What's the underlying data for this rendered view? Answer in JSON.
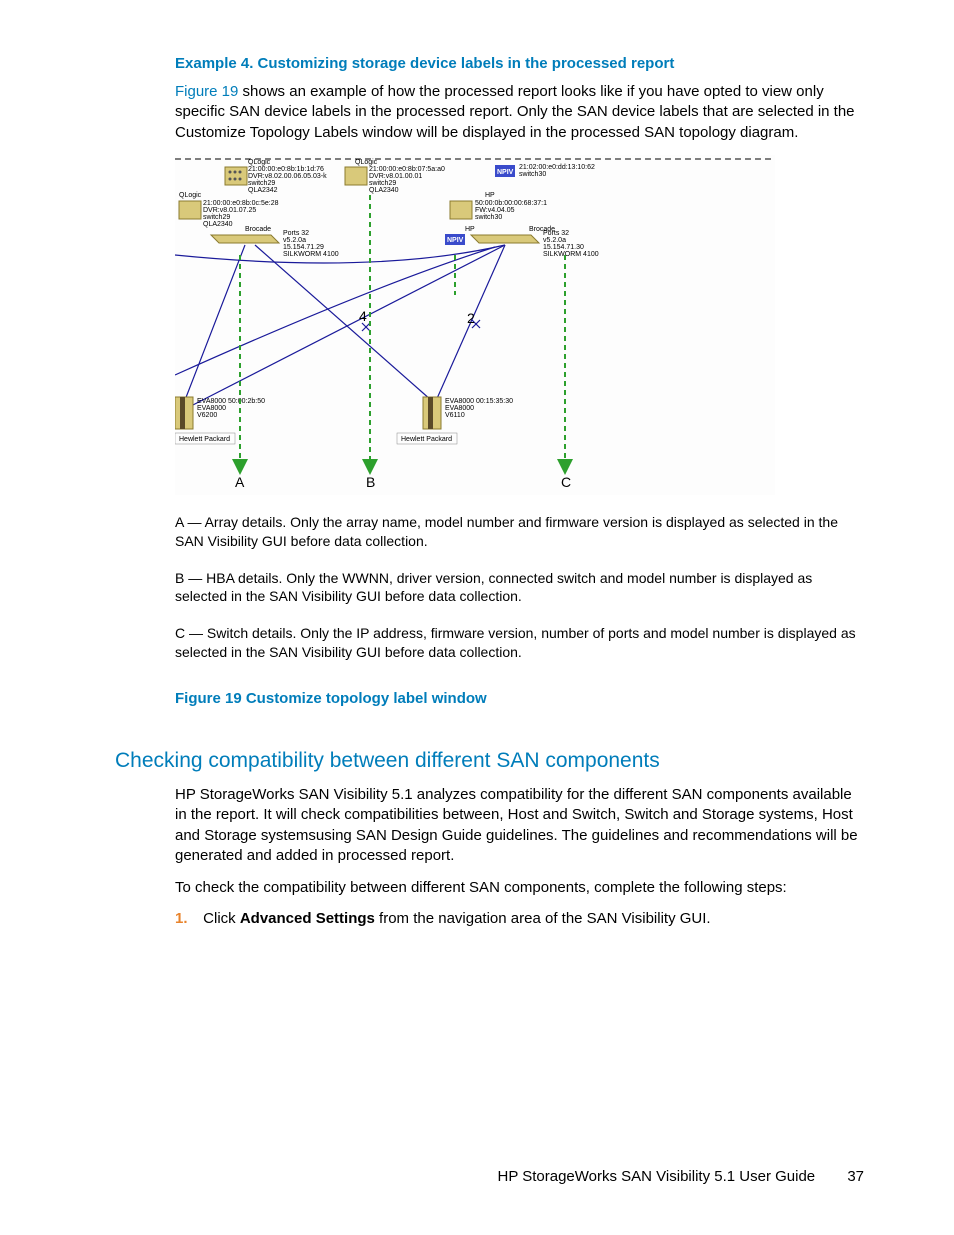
{
  "example_heading": "Example 4. Customizing storage device labels in the processed report",
  "intro_link": "Figure 19",
  "intro_rest": " shows an example of how the processed report looks like if you have opted to view only specific SAN device labels in the processed report. Only the SAN device labels that are selected in the Customize Topology Labels window will be displayed in the processed SAN topology diagram.",
  "diagram": {
    "hba1_vendor": "QLogic",
    "hba1_lines": [
      "21:00:00:e0:8b:1b:1d:76",
      "DVR:v8.02.00.06.05.03-k",
      "switch29",
      "QLA2342"
    ],
    "hba2_vendor": "QLogic",
    "hba2_lines": [
      "21:00:00:e0:8b:07:5a:a0",
      "DVR:v8.01.00.01",
      "switch29",
      "QLA2340"
    ],
    "hba3_lines": [
      "21:02:00:e0:dd:13:10:62",
      "switch30"
    ],
    "hba4_vendor": "QLogic",
    "hba4_lines": [
      "21:00:00:e0:8b:0c:5e:28",
      "DVR:v8.01.07.25",
      "switch29",
      "QLA2340"
    ],
    "hp_label": "HP",
    "hp_lines": [
      "50:00:0b:00:00:68:37:1",
      "FW:v4.04.05",
      "switch30"
    ],
    "switch1_vendor": "Brocade",
    "switch1_lines": [
      "Ports 32",
      "v5.2.0a",
      "15.154.71.29",
      "SILKWORM 4100"
    ],
    "switch2_vendor": "Brocade",
    "switch2_lines": [
      "Ports 32",
      "v5.2.0a",
      "15.154.71.30",
      "SILKWORM 4100"
    ],
    "npiv": "NPIV",
    "array1_lines": [
      "EVA8000  50:00:2b:50",
      "EVA8000",
      "V6200"
    ],
    "array1_footer": "Hewlett Packard",
    "array2_lines": [
      "EVA8000  00:15:35:30",
      "EVA8000",
      "V6110"
    ],
    "array2_footer": "Hewlett Packard",
    "num4": "4",
    "num2": "2",
    "labelA": "A",
    "labelB": "B",
    "labelC": "C"
  },
  "legendA": "A — Array details. Only the array name, model number and firmware version is displayed as selected in the SAN Visibility GUI before data collection.",
  "legendB": "B — HBA details. Only the WWNN, driver version, connected switch and model number is displayed as selected in the SAN Visibility GUI before data collection.",
  "legendC": "C — Switch details. Only the IP address, firmware version, number of ports and model number is displayed as selected in the SAN Visibility GUI before data collection.",
  "figure_caption": "Figure 19 Customize topology label window",
  "section_heading": "Checking compatibility between different SAN components",
  "section_p1": "HP StorageWorks SAN Visibility 5.1 analyzes compatibility for the different SAN components available in the report. It will check compatibilities between, Host and Switch, Switch and Storage systems, Host and Storage systemsusing SAN Design Guide guidelines. The guidelines and recommendations will be generated and added in processed report.",
  "section_p2": "To check the compatibility between different SAN components, complete the following steps:",
  "step1_num": "1.",
  "step1_a": "Click ",
  "step1_bold": "Advanced Settings",
  "step1_b": " from the navigation area of the SAN Visibility GUI.",
  "footer_title": "HP StorageWorks SAN Visibility 5.1 User Guide",
  "footer_page": "37"
}
